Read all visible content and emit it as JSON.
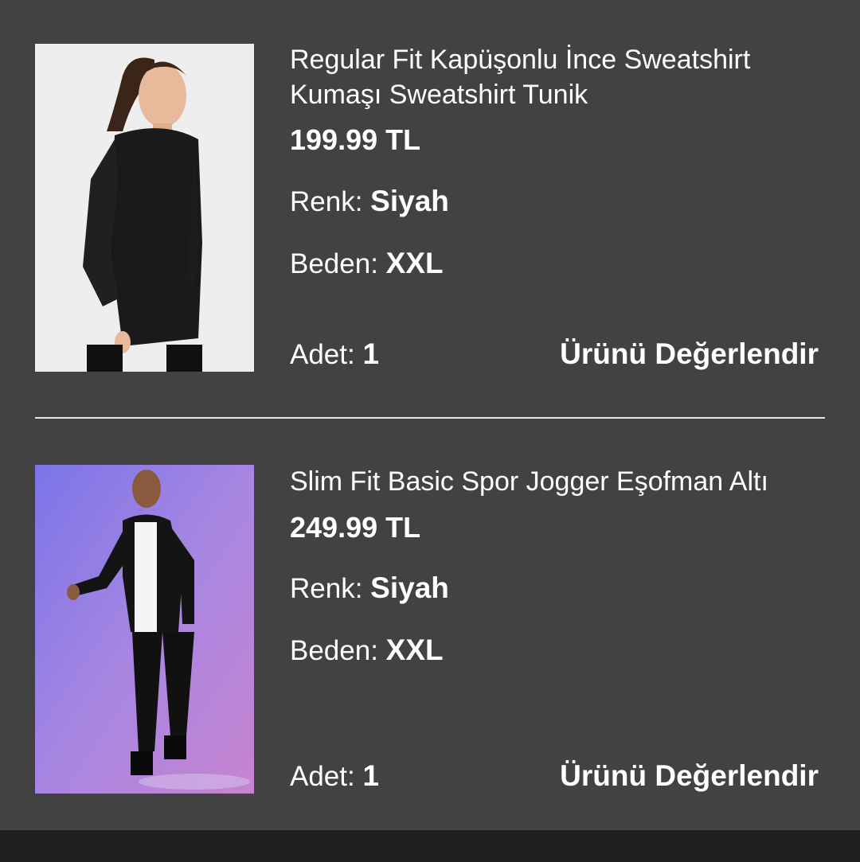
{
  "items": [
    {
      "title": "Regular Fit Kapüşonlu İnce Sweatshirt Kumaşı Sweatshirt Tunik",
      "price": "199.99 TL",
      "color_label": "Renk: ",
      "color_value": "Siyah",
      "size_label": "Beden: ",
      "size_value": "XXL",
      "qty_label": "Adet: ",
      "qty_value": "1",
      "rate_label": "Ürünü Değerlendir"
    },
    {
      "title": "Slim Fit Basic Spor Jogger Eşofman Altı",
      "price": "249.99 TL",
      "color_label": "Renk: ",
      "color_value": "Siyah",
      "size_label": "Beden: ",
      "size_value": "XXL",
      "qty_label": "Adet: ",
      "qty_value": "1",
      "rate_label": "Ürünü Değerlendir"
    }
  ],
  "colors": {
    "background": "#424242",
    "bottom_bar": "#1f1f1f",
    "divider": "#e6e6e6",
    "text": "#ffffff"
  }
}
